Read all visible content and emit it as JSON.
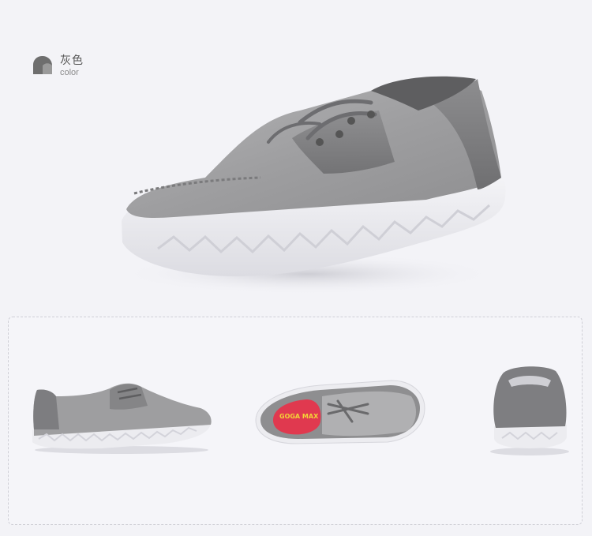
{
  "color_label": {
    "name": "灰色",
    "sub": "color",
    "swatch_color": "#6e6e6e"
  },
  "colors": {
    "background": "#f3f3f7",
    "upper": "#a3a3a5",
    "upper_dark": "#8b8b8d",
    "leather": "#868688",
    "sole": "#ececf0",
    "insole_accent": "#e0394f",
    "insole_yellow": "#f3d338"
  },
  "images": {
    "hero": "grey-canvas-boat-shoe-three-quarter-view",
    "side": "grey-boat-shoe-side-view",
    "top": "grey-boat-shoe-top-view-with-pink-insole",
    "back": "grey-boat-shoe-back-view"
  },
  "insole_text": "GOGA MAX"
}
